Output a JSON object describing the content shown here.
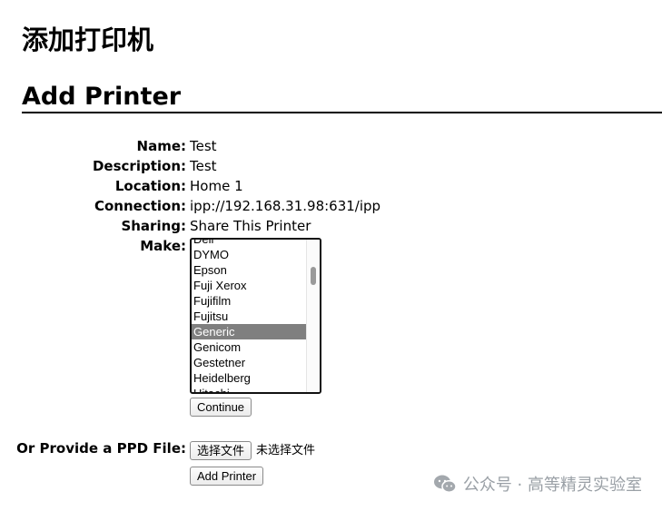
{
  "page": {
    "heading": "添加打印机",
    "section_title": "Add Printer"
  },
  "form": {
    "name": {
      "label": "Name:",
      "value": "Test"
    },
    "description": {
      "label": "Description:",
      "value": "Test"
    },
    "location": {
      "label": "Location:",
      "value": "Home 1"
    },
    "connection": {
      "label": "Connection:",
      "value": "ipp://192.168.31.98:631/ipp"
    },
    "sharing": {
      "label": "Sharing:",
      "value": "Share This Printer"
    },
    "make": {
      "label": "Make:",
      "options": [
        "Dell",
        "DYMO",
        "Epson",
        "Fuji Xerox",
        "Fujifilm",
        "Fujitsu",
        "Generic",
        "Genicom",
        "Gestetner",
        "Heidelberg",
        "Hitachi"
      ],
      "selected": "Generic"
    },
    "continue_label": "Continue",
    "ppd": {
      "label": "Or Provide a PPD File:",
      "choose_file_label": "选择文件",
      "no_file_text": "未选择文件"
    },
    "add_printer_label": "Add Printer"
  },
  "watermark": {
    "icon": "wechat-icon",
    "text": "公众号 · 高等精灵实验室"
  }
}
